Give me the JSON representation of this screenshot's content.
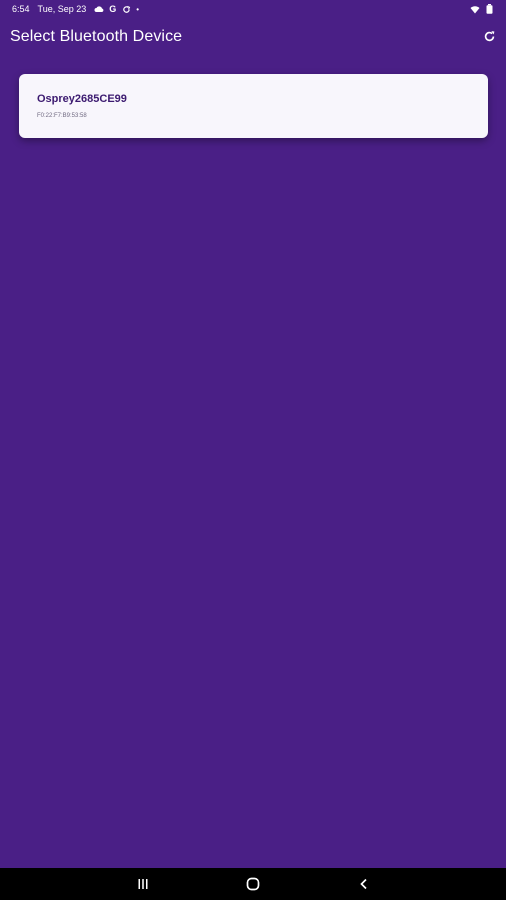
{
  "status_bar": {
    "time": "6:54",
    "date": "Tue, Sep 23",
    "icons_left": [
      "cloud-icon",
      "google-icon",
      "sync-icon",
      "dot-icon"
    ],
    "google_glyph": "G",
    "dot_glyph": "•",
    "icons_right": [
      "wifi-icon",
      "battery-icon"
    ]
  },
  "app_bar": {
    "title": "Select Bluetooth Device",
    "refresh_icon": "refresh-icon"
  },
  "devices": [
    {
      "name": "Osprey2685CE99",
      "address": "F0:22:F7:B9:53:58"
    }
  ],
  "nav_bar": {
    "recents_icon": "recents-icon",
    "home_icon": "home-icon",
    "back_icon": "back-icon"
  },
  "colors": {
    "background": "#4a1f86",
    "card": "#f8f6fc",
    "device_name": "#3c1a70",
    "nav_bar": "#000000"
  }
}
